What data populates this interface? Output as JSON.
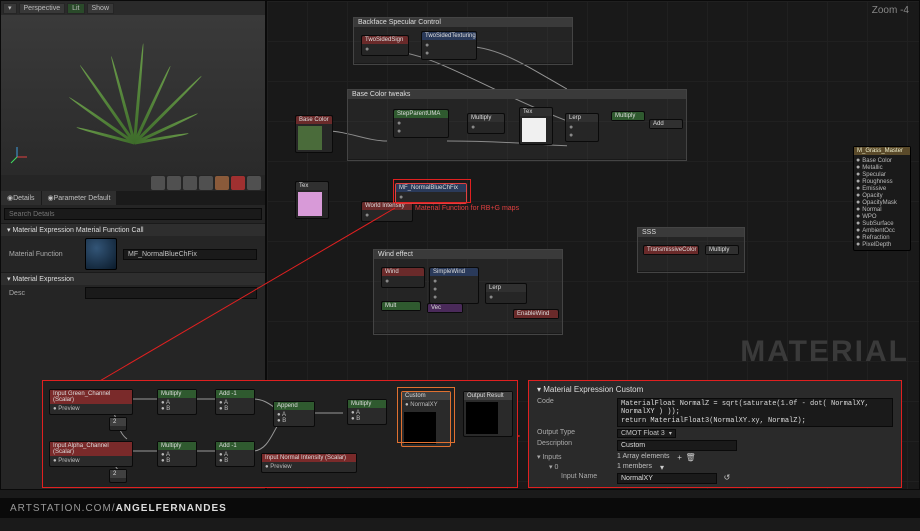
{
  "viewport": {
    "perspective": "Perspective",
    "lit": "Lit",
    "show": "Show"
  },
  "details": {
    "tab_details": "Details",
    "tab_params": "Parameter Default",
    "search_placeholder": "Search Details",
    "section1": "Material Expression Material Function Call",
    "mat_func_label": "Material Function",
    "mat_func_value": "MF_NormalBlueChFix",
    "section2": "Material Expression",
    "desc_label": "Desc"
  },
  "graph": {
    "zoom": "Zoom -4",
    "watermark": "MATERIAL",
    "comment1": "Backface Specular Control",
    "group1": "Backface Specular Control",
    "comment2": "Base Color tweaks",
    "group2": "Base Color Tweaks",
    "comment3": "Wind effect",
    "group3": "SimpleWind",
    "comment4": "SSS",
    "group4": "SSS",
    "nodes": {
      "twosided": "TwoSidedSign",
      "twosidedTex": "TwoSidedTexturing",
      "basecolor": "Base Color",
      "stepparent": "StepParentUMA",
      "mult": "Multiply",
      "add": "Add",
      "append": "Append",
      "lerp": "Lerp",
      "mf_normal": "MF_NormalBlueChFix",
      "param_green": "Input Green_Channel (Scalar)",
      "param_alpha": "Input Alpha_Channel (Scalar)",
      "param_normint": "Input Normal Intensity (Scalar)",
      "custom": "Custom",
      "normalxy": "NormalXY",
      "output": "Output Result",
      "world_intensity": "World Intensity",
      "simplewind": "SimpleWind",
      "enablewind": "EnableWind",
      "transmissive": "TransmissiveColor",
      "preview": "Preview"
    },
    "red_annotation": "Material Function for RB+G maps",
    "result_node": "M_Grass_Master",
    "result_pins": [
      "Base Color",
      "Metallic",
      "Specular",
      "Roughness",
      "Emissive",
      "Opacity",
      "OpacityMask",
      "Normal",
      "WPO",
      "SubSurface",
      "AmbientOcc",
      "Refraction",
      "PixelDepth"
    ]
  },
  "custom_panel": {
    "title": "Material Expression Custom",
    "code_label": "Code",
    "code_value": "MaterialFloat NormalZ = sqrt(saturate(1.0f - dot( NormalXY, NormalXY ) ));\nreturn MaterialFloat3(NormalXY.xy, NormalZ);",
    "outtype_label": "Output Type",
    "outtype_value": "CMOT Float 3",
    "desc_label": "Description",
    "desc_value": "Custom",
    "inputs_label": "Inputs",
    "inputs_value": "1 Array elements",
    "idx_label": "0",
    "idx_value": "1 members",
    "inputname_label": "Input Name",
    "inputname_value": "NormalXY"
  },
  "footer": {
    "domain": "ARTSTATION.COM/",
    "user": "ANGELFERNANDES"
  }
}
